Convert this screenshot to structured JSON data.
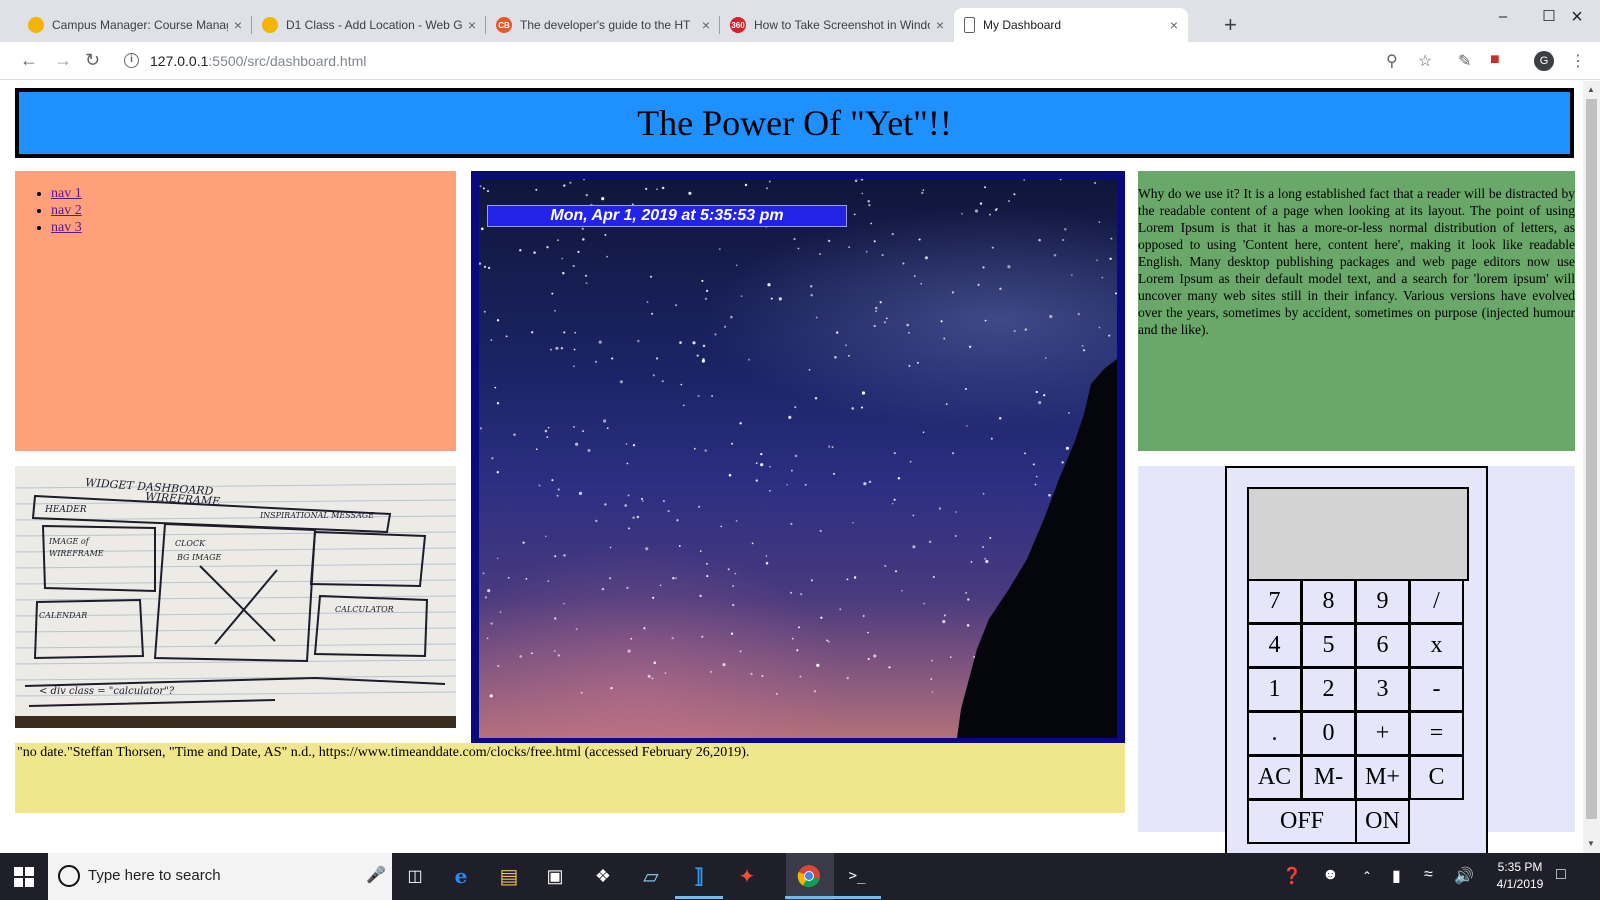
{
  "browser": {
    "tabs": [
      {
        "title": "Campus Manager: Course Manag",
        "icon_color": "#f5b400",
        "icon_text": "",
        "active": false
      },
      {
        "title": "D1 Class - Add Location - Web G",
        "icon_color": "#f5b400",
        "icon_text": "",
        "active": false
      },
      {
        "title": "The developer's guide to the HT",
        "icon_color": "#e8562a",
        "icon_text": "CB",
        "active": false
      },
      {
        "title": "How to Take Screenshot in Windo",
        "icon_color": "#d6202a",
        "icon_text": "360",
        "active": false
      },
      {
        "title": "My Dashboard",
        "icon_color": "#ffffff",
        "icon_text": "",
        "active": true
      }
    ],
    "url_host": "127.0.0.1",
    "url_path": ":5500/src/dashboard.html",
    "profile_initial": "G"
  },
  "page": {
    "title": "The Power Of \"Yet\"!!",
    "nav": [
      "nav 1",
      "nav 2",
      "nav 3"
    ],
    "clock": "Mon, Apr 1, 2019 at 5:35:53 pm",
    "lorem": "Why do we use it? It is a long established fact that a reader will be distracted by the readable content of a page when looking at its layout. The point of using Lorem Ipsum is that it has a more-or-less normal distribution of letters, as opposed to using 'Content here, content here', making it look like readable English. Many desktop publishing packages and web page editors now use Lorem Ipsum as their default model text, and a search for 'lorem ipsum' will uncover many web sites still in their infancy. Various versions have evolved over the years, sometimes by accident, sometimes on purpose (injected humour and the like).",
    "citation": "\"no date.\"Steffan Thorsen, \"Time and Date, AS\" n.d., https://www.timeanddate.com/clocks/free.html (accessed February 26,2019).",
    "calculator": {
      "display": "",
      "keys": [
        {
          "label": "7",
          "name": "calc-key-7"
        },
        {
          "label": "8",
          "name": "calc-key-8"
        },
        {
          "label": "9",
          "name": "calc-key-9"
        },
        {
          "label": "/",
          "name": "calc-key-divide"
        },
        {
          "label": "4",
          "name": "calc-key-4"
        },
        {
          "label": "5",
          "name": "calc-key-5"
        },
        {
          "label": "6",
          "name": "calc-key-6"
        },
        {
          "label": "x",
          "name": "calc-key-multiply"
        },
        {
          "label": "1",
          "name": "calc-key-1"
        },
        {
          "label": "2",
          "name": "calc-key-2"
        },
        {
          "label": "3",
          "name": "calc-key-3"
        },
        {
          "label": "-",
          "name": "calc-key-subtract"
        },
        {
          "label": ".",
          "name": "calc-key-decimal"
        },
        {
          "label": "0",
          "name": "calc-key-0"
        },
        {
          "label": "+",
          "name": "calc-key-add"
        },
        {
          "label": "=",
          "name": "calc-key-equals"
        },
        {
          "label": "AC",
          "name": "calc-key-all-clear"
        },
        {
          "label": "M-",
          "name": "calc-key-memory-minus"
        },
        {
          "label": "M+",
          "name": "calc-key-memory-plus"
        },
        {
          "label": "C",
          "name": "calc-key-clear"
        },
        {
          "label": "OFF",
          "name": "calc-key-off"
        },
        {
          "label": "ON",
          "name": "calc-key-on"
        }
      ]
    }
  },
  "taskbar": {
    "search_placeholder": "Type here to search",
    "time": "5:35 PM",
    "date": "4/1/2019"
  }
}
